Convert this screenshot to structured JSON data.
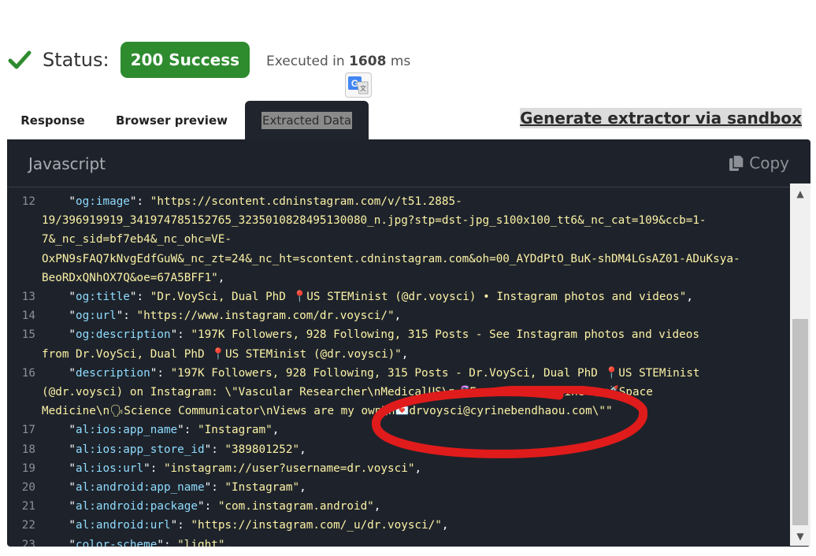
{
  "status": {
    "label": "Status:",
    "badge": "200 Success",
    "exec_prefix": "Executed in",
    "exec_ms": "1608",
    "exec_unit": "ms"
  },
  "tabs": {
    "response": "Response",
    "browser": "Browser preview",
    "extracted": "Extracted Data"
  },
  "generate_link": "Generate extractor via sandbox",
  "panel": {
    "language": "Javascript",
    "copy_label": "Copy"
  },
  "icons": {
    "status": "check-icon",
    "translate": "google-translate-icon",
    "copy": "copy-icon",
    "scroll_up": "up-triangle",
    "scroll_down": "down-triangle"
  },
  "colors": {
    "success": "#2e8b2e",
    "panel_bg": "#1e232b",
    "code_key": "#8fdcff",
    "code_string": "#fcf2a6",
    "annotation": "#e01b1b"
  },
  "code": {
    "lines": [
      {
        "num": "12",
        "parts": [
          {
            "t": "    \""
          },
          {
            "t": "og:image",
            "c": "k"
          },
          {
            "t": "\": "
          },
          {
            "t": "\"https://scontent.cdninstagram.com/v/t51.2885-",
            "c": "s"
          }
        ]
      },
      {
        "num": "",
        "parts": [
          {
            "t": "19/396919919_341974785152765_3235010828495130080_n.jpg?stp=dst-jpg_s100x100_tt6&_nc_cat=109&ccb=1-",
            "c": "s"
          }
        ]
      },
      {
        "num": "",
        "parts": [
          {
            "t": "7&_nc_sid=bf7eb4&_nc_ohc=VE-",
            "c": "s"
          }
        ]
      },
      {
        "num": "",
        "parts": [
          {
            "t": "OxPN9sFAQ7kNvgEdfGuW&_nc_zt=24&_nc_ht=scontent.cdninstagram.com&oh=00_AYDdPtO_BuK-shDM4LGsAZ01-ADuKsya-",
            "c": "s"
          }
        ]
      },
      {
        "num": "",
        "parts": [
          {
            "t": "BeoRDxQNhOX7Q&oe=67A5BFF1\"",
            "c": "s"
          },
          {
            "t": ","
          }
        ]
      },
      {
        "num": "13",
        "parts": [
          {
            "t": "    \""
          },
          {
            "t": "og:title",
            "c": "k"
          },
          {
            "t": "\": "
          },
          {
            "t": "\"Dr.VoySci, Dual PhD 📍US STEMinist (@dr.voysci) • Instagram photos and videos\"",
            "c": "s"
          },
          {
            "t": ","
          }
        ]
      },
      {
        "num": "14",
        "parts": [
          {
            "t": "    \""
          },
          {
            "t": "og:url",
            "c": "k"
          },
          {
            "t": "\": "
          },
          {
            "t": "\"https://www.instagram.com/dr.voysci/\"",
            "c": "s"
          },
          {
            "t": ","
          }
        ]
      },
      {
        "num": "15",
        "parts": [
          {
            "t": "    \""
          },
          {
            "t": "og:description",
            "c": "k"
          },
          {
            "t": "\": "
          },
          {
            "t": "\"197K Followers, 928 Following, 315 Posts - See Instagram photos and videos",
            "c": "s"
          }
        ]
      },
      {
        "num": "",
        "parts": [
          {
            "t": "from Dr.VoySci, Dual PhD 📍US STEMinist (@dr.voysci)\"",
            "c": "s"
          },
          {
            "t": ","
          }
        ]
      },
      {
        "num": "16",
        "parts": [
          {
            "t": "    \""
          },
          {
            "t": "description",
            "c": "k"
          },
          {
            "t": "\": "
          },
          {
            "t": "\"197K Followers, 928 Following, 315 Posts - Dr.VoySci, Dual PhD 📍US STEMinist",
            "c": "s"
          }
        ]
      },
      {
        "num": "",
        "parts": [
          {
            "t": "(@dr.voysci) on Instagram: \\\"Vascular Researcher\\nMedicalUS\\n🧬Forensic Medicine \\n🚀Space",
            "c": "s"
          }
        ]
      },
      {
        "num": "",
        "parts": [
          {
            "t": "Medicine\\n🗣Science Communicator\\nViews are my own\\n💌drvoysci@cyrinebendhaou.com\\\"\"",
            "c": "s"
          }
        ]
      },
      {
        "num": "17",
        "parts": [
          {
            "t": "    \""
          },
          {
            "t": "al:ios:app_name",
            "c": "k"
          },
          {
            "t": "\": "
          },
          {
            "t": "\"Instagram\"",
            "c": "s"
          },
          {
            "t": ","
          }
        ]
      },
      {
        "num": "18",
        "parts": [
          {
            "t": "    \""
          },
          {
            "t": "al:ios:app_store_id",
            "c": "k"
          },
          {
            "t": "\": "
          },
          {
            "t": "\"389801252\"",
            "c": "s"
          },
          {
            "t": ","
          }
        ]
      },
      {
        "num": "19",
        "parts": [
          {
            "t": "    \""
          },
          {
            "t": "al:ios:url",
            "c": "k"
          },
          {
            "t": "\": "
          },
          {
            "t": "\"instagram://user?username=dr.voysci\"",
            "c": "s"
          },
          {
            "t": ","
          }
        ]
      },
      {
        "num": "20",
        "parts": [
          {
            "t": "    \""
          },
          {
            "t": "al:android:app_name",
            "c": "k"
          },
          {
            "t": "\": "
          },
          {
            "t": "\"Instagram\"",
            "c": "s"
          },
          {
            "t": ","
          }
        ]
      },
      {
        "num": "21",
        "parts": [
          {
            "t": "    \""
          },
          {
            "t": "al:android:package",
            "c": "k"
          },
          {
            "t": "\": "
          },
          {
            "t": "\"com.instagram.android\"",
            "c": "s"
          },
          {
            "t": ","
          }
        ]
      },
      {
        "num": "22",
        "parts": [
          {
            "t": "    \""
          },
          {
            "t": "al:android:url",
            "c": "k"
          },
          {
            "t": "\": "
          },
          {
            "t": "\"https://instagram.com/_u/dr.voysci/\"",
            "c": "s"
          },
          {
            "t": ","
          }
        ]
      },
      {
        "num": "23",
        "parts": [
          {
            "t": "    \""
          },
          {
            "t": "color-scheme",
            "c": "k"
          },
          {
            "t": "\": "
          },
          {
            "t": "\"light\"",
            "c": "s"
          },
          {
            "t": ","
          }
        ]
      }
    ]
  }
}
